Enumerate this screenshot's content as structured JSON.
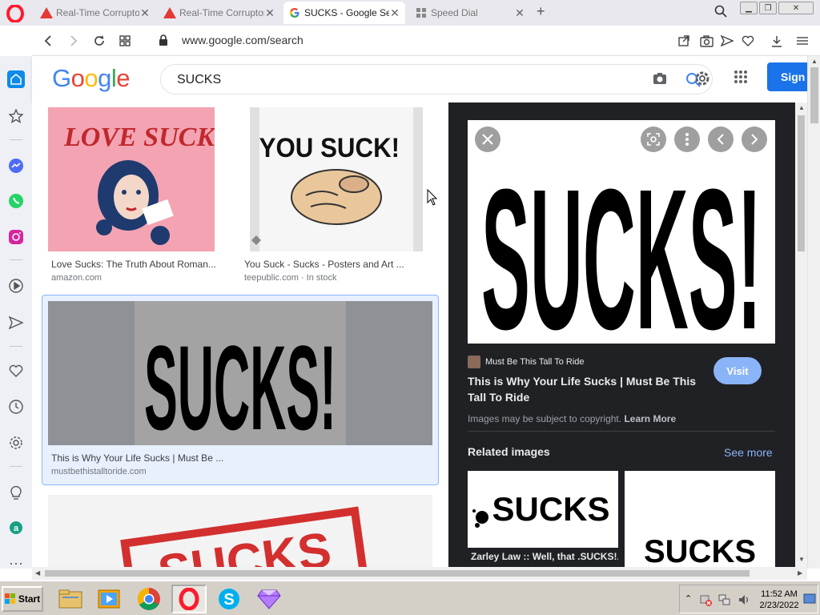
{
  "browser": {
    "tabs": [
      {
        "label": "Real-Time Corruptor",
        "active": false
      },
      {
        "label": "Real-Time Corruptor",
        "active": false
      },
      {
        "label": "SUCKS - Google Sear",
        "active": true
      },
      {
        "label": "Speed Dial",
        "active": false
      }
    ],
    "url": "www.google.com/search"
  },
  "google": {
    "logo_letters": [
      "G",
      "o",
      "o",
      "g",
      "l",
      "e"
    ],
    "query": "SUCKS",
    "sign_in_label": "Sign"
  },
  "results": [
    {
      "title": "Love Sucks: The Truth About Roman...",
      "source": "amazon.com",
      "image_text": "LOVE SUCKS"
    },
    {
      "title": "You Suck - Sucks - Posters and Art ...",
      "source": "teepublic.com · In stock",
      "image_text": "YOU SUCK!"
    },
    {
      "title": "This is Why Your Life Sucks | Must Be ...",
      "source": "mustbethistalltoride.com",
      "image_text": "SUCKS!"
    },
    {
      "image_text": "SUCKS"
    }
  ],
  "preview": {
    "image_text": "SUCKS!",
    "source_name": "Must Be This Tall To Ride",
    "title": "This is Why Your Life Sucks | Must Be This Tall To Ride",
    "visit_label": "Visit",
    "copyright_text": "Images may be subject to copyright.",
    "learn_more": "Learn More",
    "related_heading": "Related images",
    "see_more": "See more",
    "related": [
      {
        "image_text": "SUCKS",
        "caption": "Zarley Law :: Well, that .SUCKS!..."
      },
      {
        "image_text": "SUCKS",
        "caption": ""
      }
    ]
  },
  "taskbar": {
    "start_label": "Start",
    "time": "11:52 AM",
    "date": "2/23/2022"
  },
  "colors": {
    "google_blue": "#4285F4",
    "google_red": "#EA4335",
    "google_yellow": "#FBBC05",
    "google_green": "#34A853",
    "preview_bg": "#202124",
    "link_blue": "#8ab4f8",
    "opera_red": "#ff1b2d"
  }
}
